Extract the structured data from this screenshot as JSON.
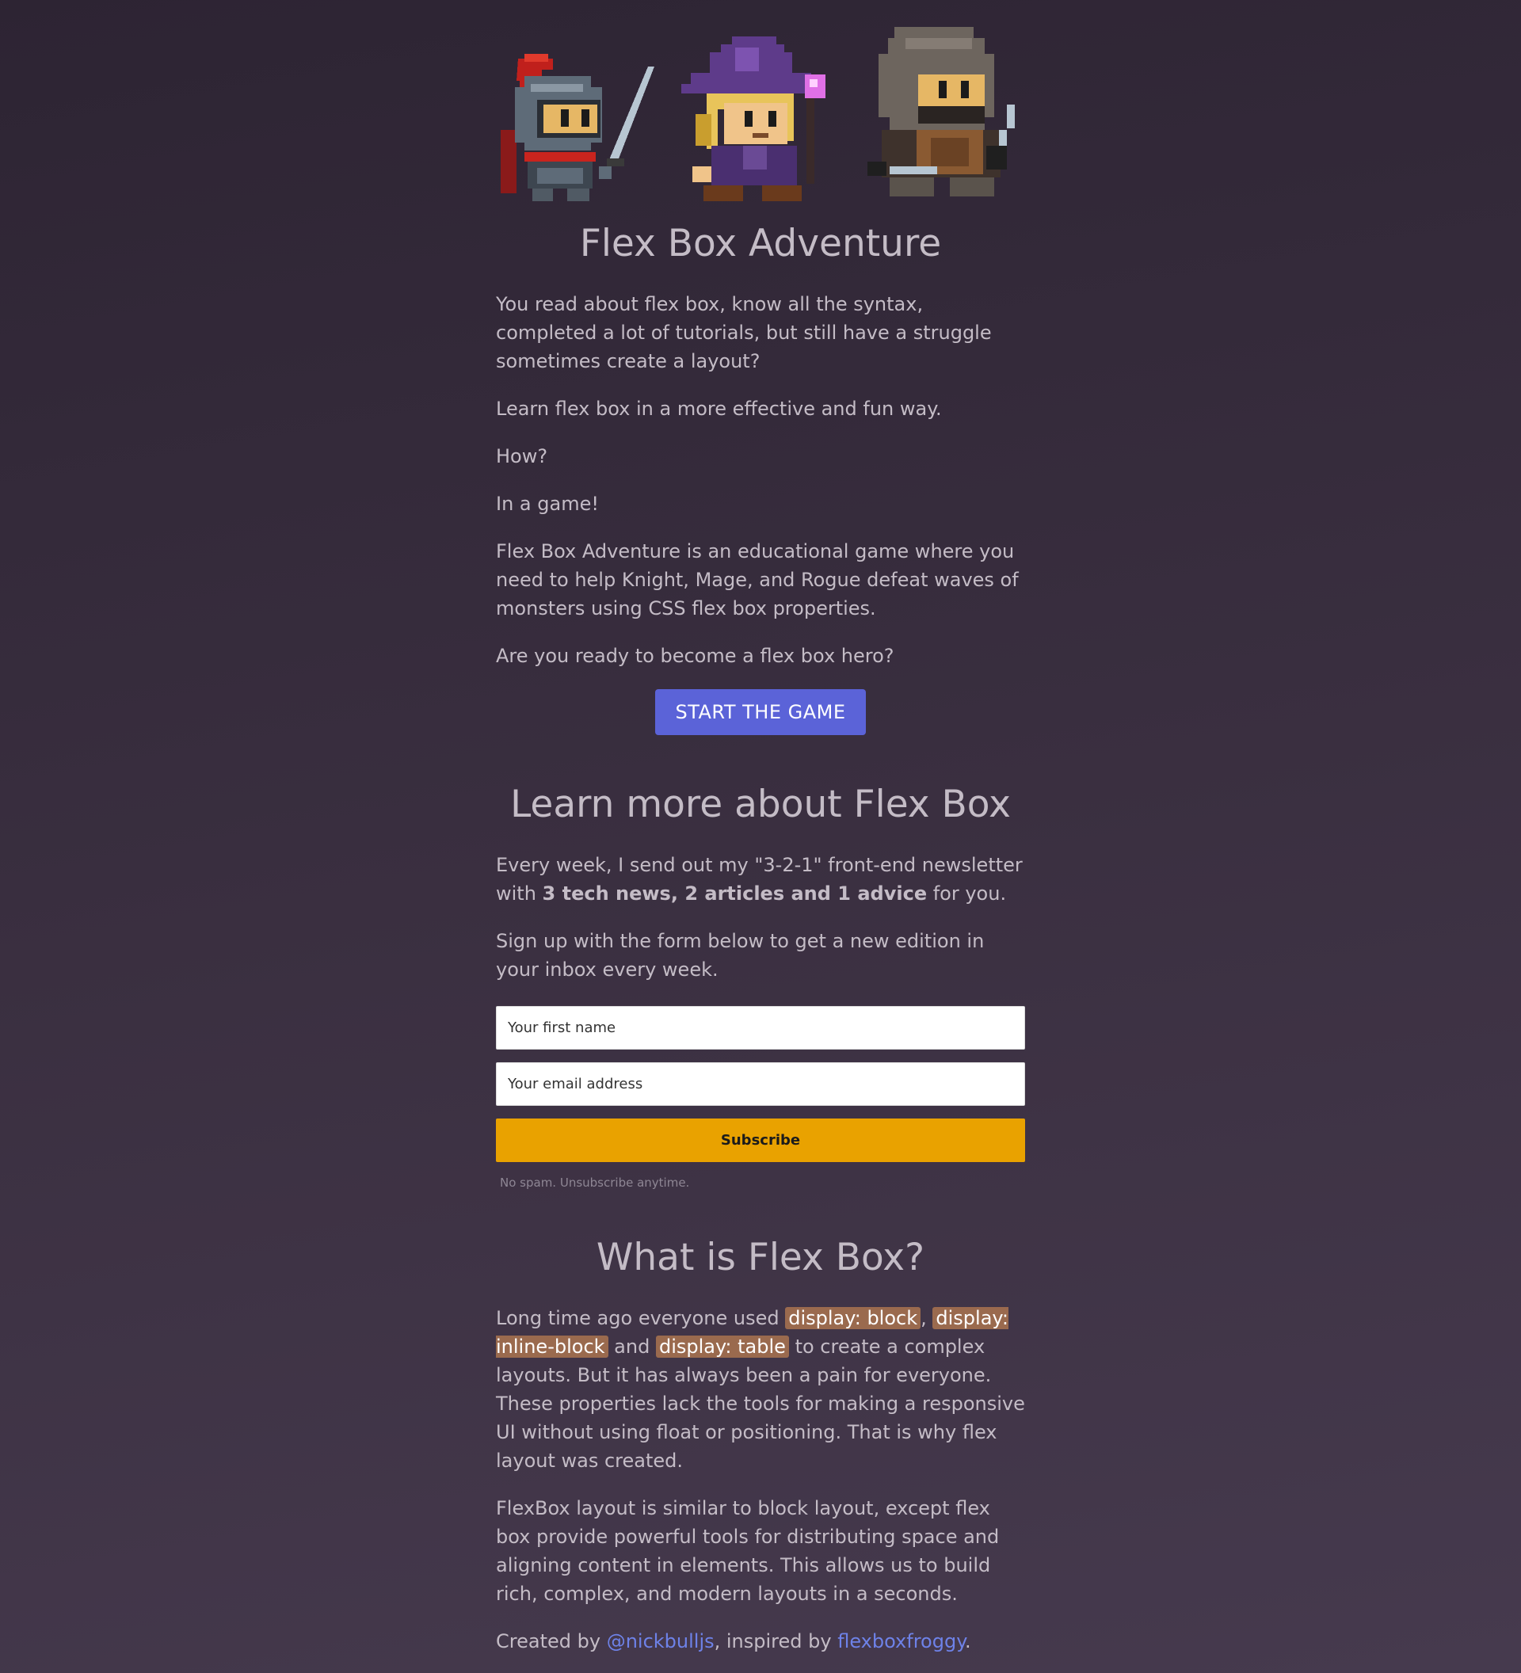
{
  "heroes": [
    {
      "name": "Knight",
      "icon": "knight-icon"
    },
    {
      "name": "Mage",
      "icon": "mage-icon"
    },
    {
      "name": "Rogue",
      "icon": "rogue-icon"
    }
  ],
  "intro": {
    "title": "Flex Box Adventure",
    "p1": "You read about flex box, know all the syntax, completed a lot of tutorials, but still have a struggle sometimes create a layout?",
    "p2": "Learn flex box in a more effective and fun way.",
    "p3": "How?",
    "p4": "In a game!",
    "p5": "Flex Box Adventure is an educational game where you need to help Knight, Mage, and Rogue defeat waves of monsters using CSS flex box properties.",
    "p6": "Are you ready to become a flex box hero?",
    "start_label": "START THE GAME"
  },
  "newsletter": {
    "title": "Learn more about Flex Box",
    "p1_before": "Every week, I send out my \"3-2-1\" front-end newsletter with ",
    "p1_bold": "3 tech news, 2 articles and 1 advice",
    "p1_after": " for you.",
    "p2": "Sign up with the form below to get a new edition in your inbox every week.",
    "first_name_placeholder": "Your first name",
    "email_placeholder": "Your email address",
    "subscribe_label": "Subscribe",
    "nospam": "No spam. Unsubscribe anytime."
  },
  "what": {
    "title": "What is Flex Box?",
    "p1_a": "Long time ago everyone used ",
    "code1": "display: block",
    "p1_b": ", ",
    "code2": "display: inline-block",
    "p1_c": " and ",
    "code3": "display: table",
    "p1_d": " to create a complex layouts. But it has always been a pain for everyone. These properties lack the tools for making a responsive UI without using float or positioning. That is why flex layout was created.",
    "p2": "FlexBox layout is similar to block layout, except flex box provide powerful tools for distributing space and aligning content in elements. This allows us to build rich, complex, and modern layouts in a seconds.",
    "credit_a": "Created by ",
    "author": "@nickbulljs",
    "credit_b": ", inspired by ",
    "inspiration": "flexboxfroggy",
    "credit_c": "."
  },
  "colors": {
    "accent": "#5b63d8",
    "subscribe": "#e9a200",
    "link": "#6e82e8",
    "code_bg": "#9a6a4e"
  }
}
